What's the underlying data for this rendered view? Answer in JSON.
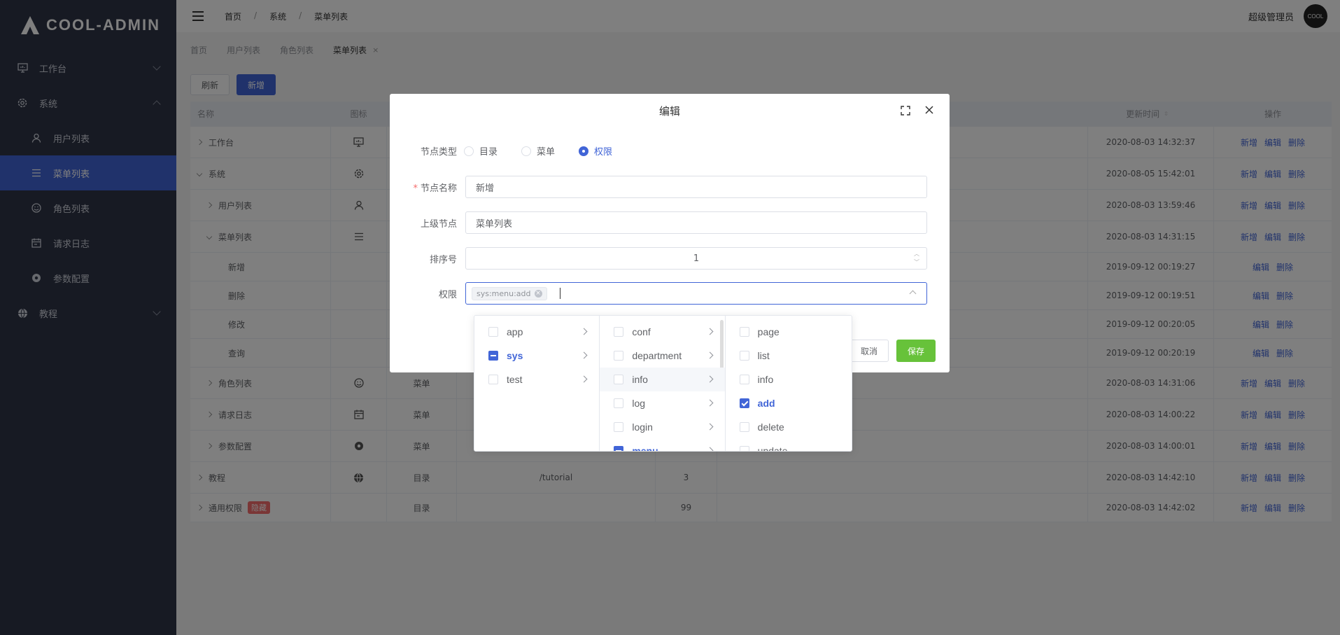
{
  "app": {
    "title": "COOL-ADMIN"
  },
  "sidebar": {
    "items": [
      {
        "label": "工作台",
        "icon": "dashboard-icon"
      },
      {
        "label": "系统",
        "icon": "gear-icon"
      },
      {
        "label": "用户列表",
        "icon": "user-icon"
      },
      {
        "label": "菜单列表",
        "icon": "menu-icon"
      },
      {
        "label": "角色列表",
        "icon": "smile-icon"
      },
      {
        "label": "请求日志",
        "icon": "calendar-icon"
      },
      {
        "label": "参数配置",
        "icon": "record-icon"
      },
      {
        "label": "教程",
        "icon": "globe-icon"
      }
    ]
  },
  "header": {
    "breadcrumb": [
      "首页",
      "系统",
      "菜单列表"
    ],
    "separator": "/",
    "user": "超级管理员",
    "avatar_text": "COOL"
  },
  "tabs": [
    {
      "label": "首页"
    },
    {
      "label": "用户列表"
    },
    {
      "label": "角色列表"
    },
    {
      "label": "菜单列表"
    }
  ],
  "tab_close": "×",
  "toolbar": {
    "refresh": "刷新",
    "add": "新增"
  },
  "table": {
    "headers": [
      "名称",
      "图标",
      "",
      "",
      "",
      "",
      "更新时间",
      "操作"
    ],
    "ops": {
      "add": "新增",
      "edit": "编辑",
      "delete": "删除"
    },
    "rows": [
      {
        "name": "工作台",
        "type": "",
        "path": "",
        "order": "",
        "time": "2020-08-03 14:32:37"
      },
      {
        "name": "系统",
        "type": "",
        "path": "",
        "order": "",
        "time": "2020-08-05 15:42:01"
      },
      {
        "name": "用户列表",
        "type": "",
        "path": "",
        "order": "",
        "time": "2020-08-03 13:59:46"
      },
      {
        "name": "菜单列表",
        "type": "",
        "path": "",
        "order": "",
        "time": "2020-08-03 14:31:15"
      },
      {
        "name": "新增",
        "type": "",
        "path": "",
        "order": "",
        "time": "2019-09-12 00:19:27"
      },
      {
        "name": "删除",
        "type": "",
        "path": "",
        "order": "",
        "time": "2019-09-12 00:19:51"
      },
      {
        "name": "修改",
        "type": "",
        "path": "",
        "order": "",
        "time": "2019-09-12 00:20:05"
      },
      {
        "name": "查询",
        "type": "",
        "path": "",
        "order": "",
        "time": "2019-09-12 00:20:19"
      },
      {
        "name": "角色列表",
        "type": "菜单",
        "path": "",
        "order": "",
        "time": "2020-08-03 14:31:06"
      },
      {
        "name": "请求日志",
        "type": "菜单",
        "path": "",
        "order": "",
        "time": "2020-08-03 14:00:22"
      },
      {
        "name": "参数配置",
        "type": "菜单",
        "path": "",
        "order": "",
        "time": "2020-08-03 14:00:01"
      },
      {
        "name": "教程",
        "type": "目录",
        "path": "/tutorial",
        "order": "3",
        "time": "2020-08-03 14:42:10"
      },
      {
        "name": "通用权限",
        "type": "目录",
        "path": "",
        "order": "99",
        "time": "2020-08-03 14:42:02",
        "badge": "隐藏"
      }
    ]
  },
  "dialog": {
    "title": "编辑",
    "fields": {
      "node_type": {
        "label": "节点类型",
        "options": [
          "目录",
          "菜单",
          "权限"
        ],
        "selected": "权限"
      },
      "node_name": {
        "label": "节点名称",
        "value": "新增",
        "required_mark": "*"
      },
      "parent_node": {
        "label": "上级节点",
        "value": "菜单列表"
      },
      "order": {
        "label": "排序号",
        "value": "1"
      },
      "permission": {
        "label": "权限",
        "tag": "sys:menu:add",
        "tag_close": "×"
      }
    },
    "cancel": "取消",
    "save": "保存"
  },
  "cascader": {
    "col1": [
      "app",
      "sys",
      "test"
    ],
    "col2": [
      "conf",
      "department",
      "info",
      "log",
      "login",
      "menu"
    ],
    "col3": [
      "page",
      "list",
      "info",
      "add",
      "delete",
      "update"
    ]
  }
}
